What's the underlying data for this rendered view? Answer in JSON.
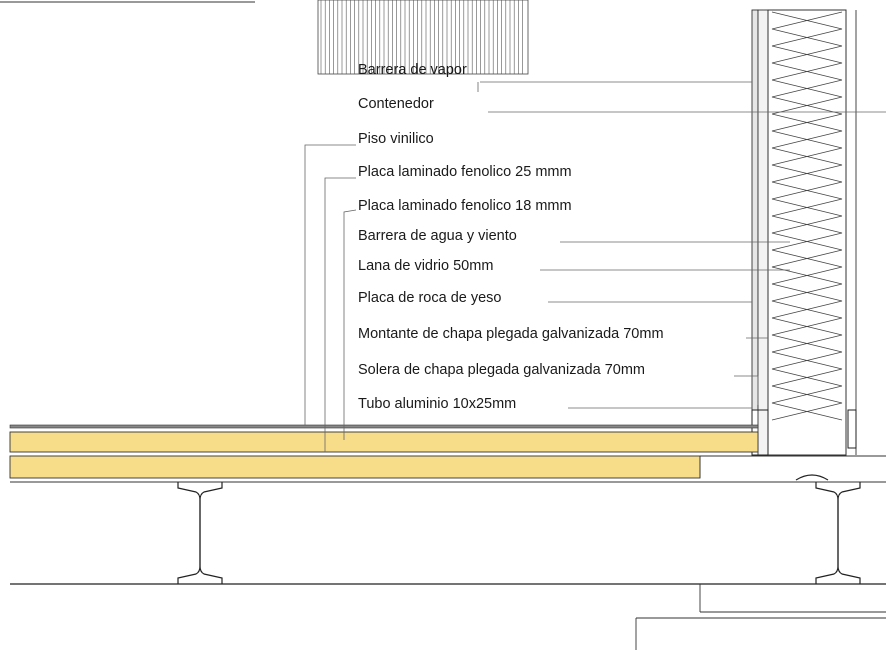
{
  "labels": {
    "barrera_vapor": "Barrera de vapor",
    "contenedor": "Contenedor",
    "piso_vinilico": "Piso vinilico",
    "placa_25": "Placa laminado fenolico 25 mmm",
    "placa_18": "Placa laminado fenolico 18 mmm",
    "barrera_agua": "Barrera de agua y viento",
    "lana_vidrio": "Lana de vidrio 50mm",
    "placa_yeso": "Placa de roca de yeso",
    "montante": "Montante de chapa plegada galvanizada 70mm",
    "solera": "Solera de chapa plegada galvanizada 70mm",
    "tubo": "Tubo aluminio 10x25mm"
  },
  "colors": {
    "plywood_fill": "#f7dc8a",
    "insulation_fill": "#d9d9d9",
    "line": "#333333"
  }
}
